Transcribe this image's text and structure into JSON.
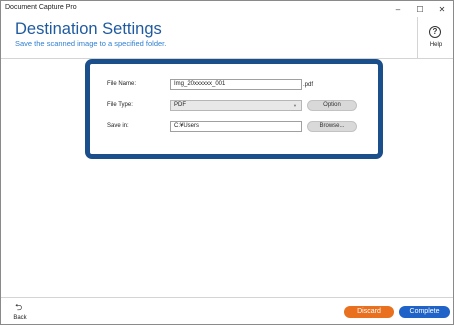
{
  "window": {
    "title": "Document Capture Pro",
    "minimize": "–",
    "maximize": "☐",
    "close": "✕"
  },
  "header": {
    "title": "Destination Settings",
    "subtitle": "Save the scanned image to a specified folder."
  },
  "help": {
    "icon_glyph": "?",
    "label": "Help"
  },
  "form": {
    "file_name": {
      "label": "File Name:",
      "value": "Img_20xxxxxx_001",
      "extension": ".pdf"
    },
    "file_type": {
      "label": "File Type:",
      "value": "PDF",
      "caret": "▼",
      "option_button": "Option"
    },
    "save_in": {
      "label": "Save in:",
      "value": "C:¥Users",
      "browse_button": "Browse..."
    }
  },
  "footer": {
    "back_icon_glyph": "⮌",
    "back_label": "Back",
    "discard_label": "Discard",
    "complete_label": "Complete"
  },
  "colors": {
    "title": "#1f5a9e",
    "subtitle": "#2f7fd1",
    "panel_border": "#1a4f8b",
    "discard": "#e8701f",
    "complete": "#1f63c9"
  }
}
